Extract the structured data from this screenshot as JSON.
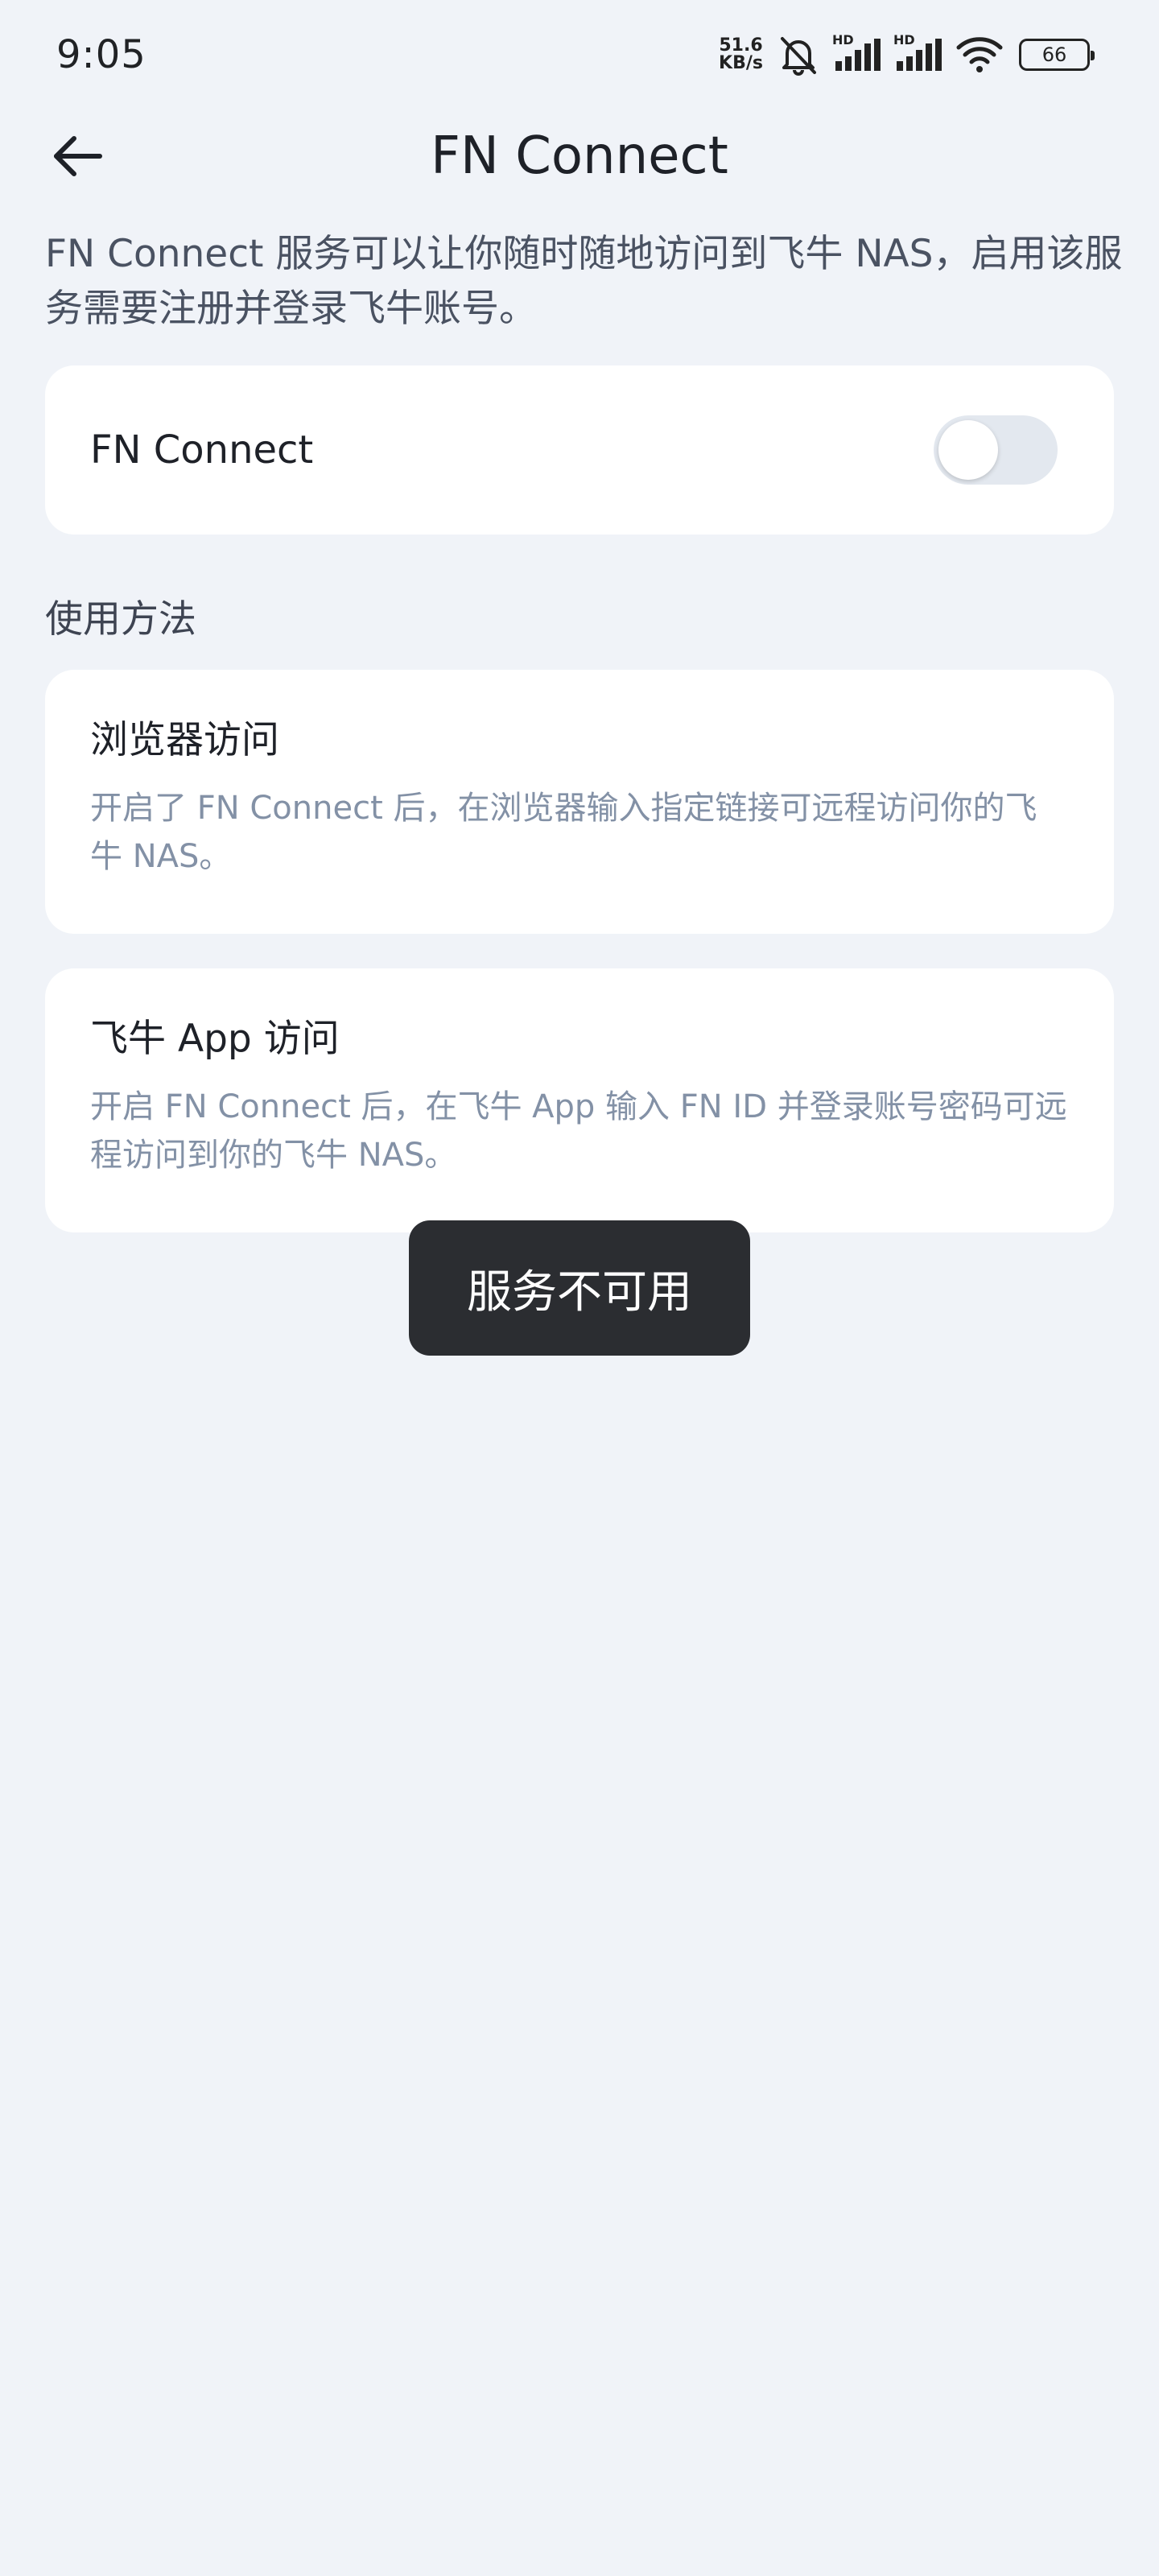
{
  "status_bar": {
    "time": "9:05",
    "net_speed_value": "51.6",
    "net_speed_unit": "KB/s",
    "hd_label_1": "HD",
    "hd_label_2": "HD",
    "battery": "66",
    "icons": [
      "mute-icon",
      "signal-icon",
      "signal-icon",
      "wifi-icon",
      "battery-icon"
    ]
  },
  "header": {
    "title": "FN Connect",
    "back_icon": "arrow-left-icon"
  },
  "intro": {
    "text": "FN Connect 服务可以让你随时随地访问到飞牛 NAS，启用该服务需要注册并登录飞牛账号。"
  },
  "toggle": {
    "label": "FN Connect",
    "enabled": false,
    "track_color": "#e3e8ef"
  },
  "usage": {
    "section_title": "使用方法",
    "methods": [
      {
        "title": "浏览器访问",
        "description": "开启了 FN Connect 后，在浏览器输入指定链接可远程访问你的飞牛 NAS。"
      },
      {
        "title": "飞牛 App 访问",
        "description": "开启 FN Connect 后，在飞牛 App 输入 FN ID 并登录账号密码可远程访问到你的飞牛 NAS。"
      }
    ]
  },
  "toast": {
    "message": "服务不可用"
  },
  "colors": {
    "background": "#f0f3f8",
    "card": "#ffffff",
    "secondary_text": "#8391a6",
    "toast_bg": "#2b2d31"
  }
}
